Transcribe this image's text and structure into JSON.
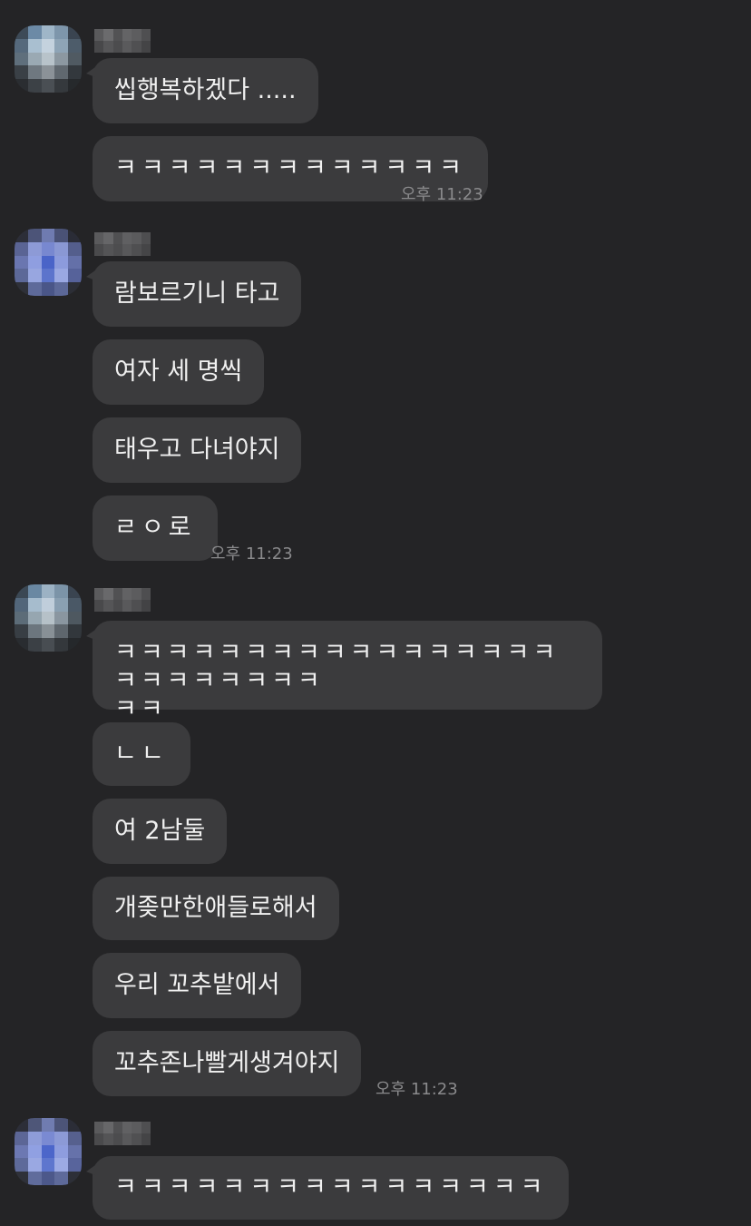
{
  "messages": [
    {
      "text": "씹행복하겠다 ....."
    },
    {
      "text": "ㅋㅋㅋㅋㅋㅋㅋㅋㅋㅋㅋㅋㅋ",
      "time": "오후 11:23"
    },
    {
      "text": "람보르기니 타고"
    },
    {
      "text": "여자 세 명씩"
    },
    {
      "text": "태우고 다녀야지"
    },
    {
      "text": "ㄹㅇ로",
      "time": "오후 11:23"
    },
    {
      "text": "ㅋㅋㅋㅋㅋㅋㅋㅋㅋㅋㅋㅋㅋㅋㅋㅋㅋㅋㅋㅋㅋㅋㅋㅋㅋ\nㅋㅋ"
    },
    {
      "text": "ㄴㄴ"
    },
    {
      "text": "여 2남둘"
    },
    {
      "text": "개좆만한애들로해서"
    },
    {
      "text": "우리 꼬추밭에서"
    },
    {
      "text": "꼬추존나빨게생겨야지",
      "time": "오후 11:23"
    },
    {
      "text": "ㅋㅋㅋㅋㅋㅋㅋㅋㅋㅋㅋㅋㅋㅋㅋㅋ"
    }
  ],
  "colors": {
    "background": "#242426",
    "bubble": "#3b3b3d",
    "text": "#f0f0f0",
    "timestamp": "#8a8a8c"
  }
}
